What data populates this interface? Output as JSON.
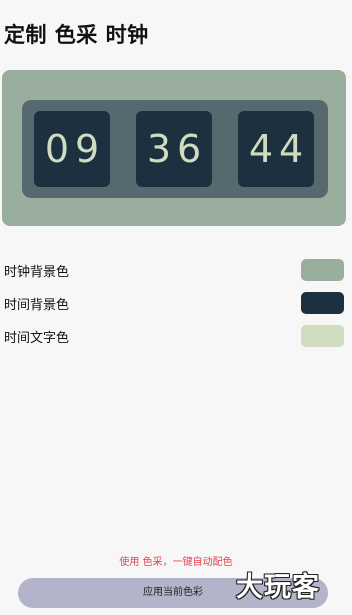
{
  "page": {
    "title": "定制 色采 时钟"
  },
  "clock": {
    "hours": "09",
    "minutes": "36",
    "seconds": "44",
    "colors": {
      "clock_background": "#9aae9e",
      "frame": "#56696e",
      "time_background": "#1c3040",
      "time_text": "#cfdcc0"
    }
  },
  "settings": [
    {
      "label": "时钟背景色",
      "color": "#9aae9e"
    },
    {
      "label": "时间背景色",
      "color": "#1c3040"
    },
    {
      "label": "时间文字色",
      "color": "#cfdcc0"
    }
  ],
  "footer": {
    "hint": "使用 色采，一键自动配色",
    "hint_color": "#e2434b",
    "apply_label": "应用当前色彩"
  },
  "watermark": {
    "text": "大玩客"
  }
}
